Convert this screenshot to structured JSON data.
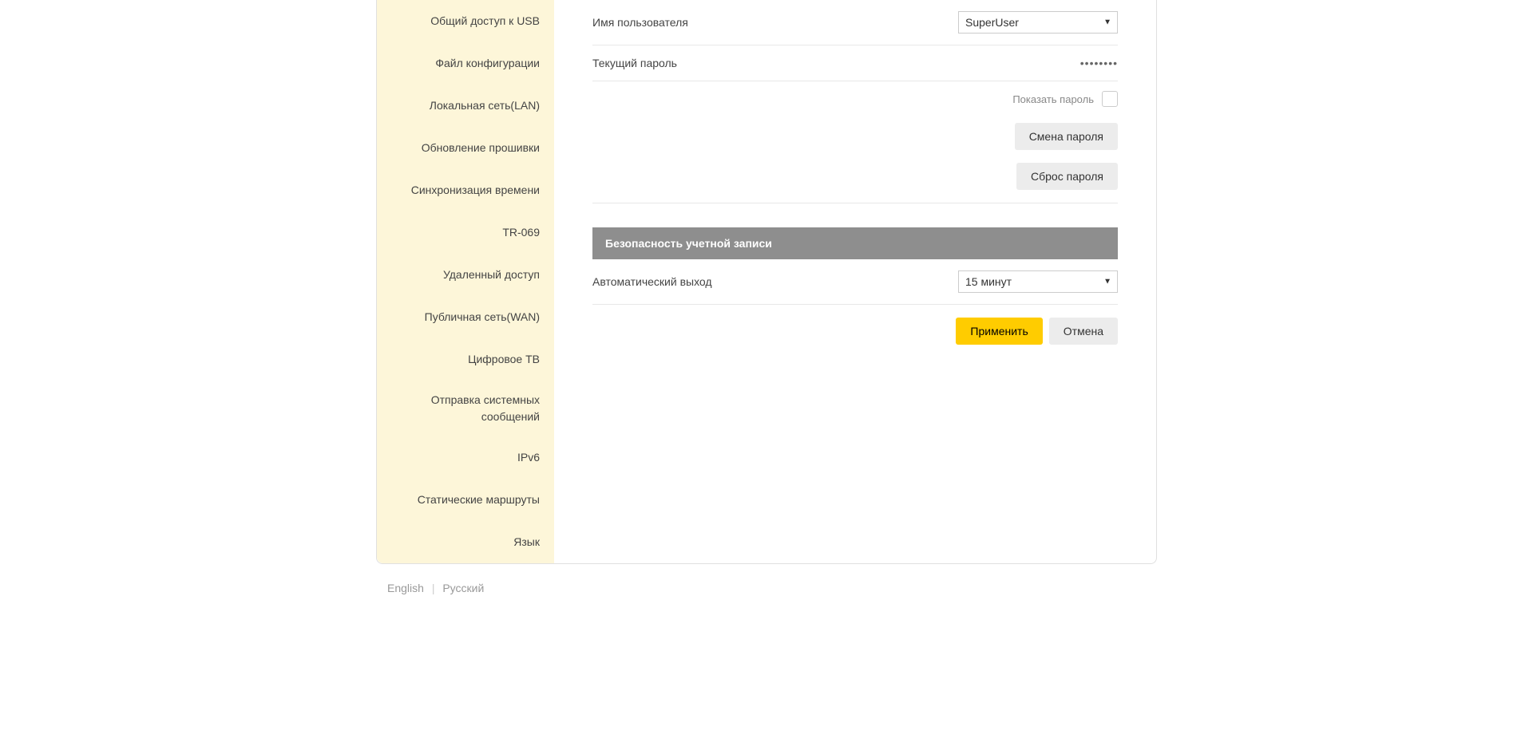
{
  "sidebar": {
    "items": [
      {
        "label": "Общий доступ к USB"
      },
      {
        "label": "Файл конфигурации"
      },
      {
        "label": "Локальная сеть(LAN)"
      },
      {
        "label": "Обновление прошивки"
      },
      {
        "label": "Синхронизация времени"
      },
      {
        "label": "TR-069"
      },
      {
        "label": "Удаленный доступ"
      },
      {
        "label": "Публичная сеть(WAN)"
      },
      {
        "label": "Цифровое ТВ"
      },
      {
        "label": "Отправка системных сообщений"
      },
      {
        "label": "IPv6"
      },
      {
        "label": "Статические маршруты"
      },
      {
        "label": "Язык"
      }
    ]
  },
  "form": {
    "username_label": "Имя пользователя",
    "username_value": "SuperUser",
    "password_label": "Текущий пароль",
    "password_value": "••••••••",
    "show_password_label": "Показать пароль",
    "change_password_btn": "Смена пароля",
    "reset_password_btn": "Сброс пароля"
  },
  "security": {
    "header": "Безопасность учетной записи",
    "auto_logout_label": "Автоматический выход",
    "auto_logout_value": "15 минут"
  },
  "actions": {
    "apply": "Применить",
    "cancel": "Отмена"
  },
  "footer": {
    "english": "English",
    "russian": "Русский"
  }
}
